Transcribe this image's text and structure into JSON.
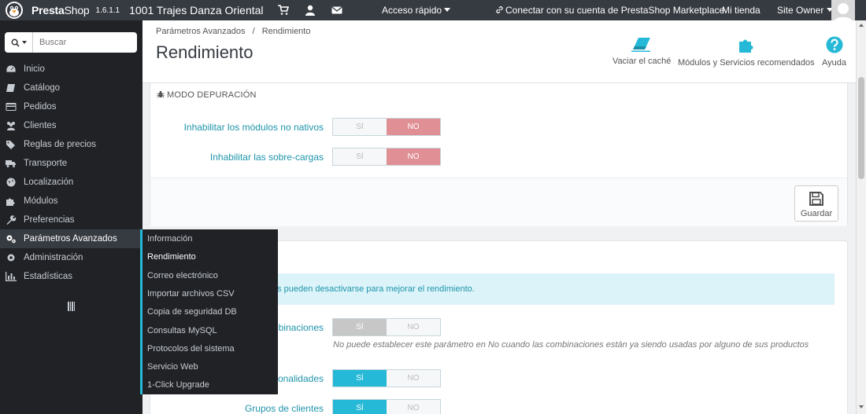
{
  "topbar": {
    "brand_pre": "Presta",
    "brand_post": "Shop",
    "version": "1.6.1.1",
    "shop_name": "1001 Trajes Danza Oriental",
    "quick_access": "Acceso rápido",
    "connect": "Conectar con su cuenta de PrestaShop Marketplace",
    "my_store": "Mi tienda",
    "user": "Site Owner"
  },
  "search": {
    "placeholder": "Buscar"
  },
  "sidebar": {
    "items": [
      {
        "label": "Inicio",
        "icon": "tachometer-icon"
      },
      {
        "label": "Catálogo",
        "icon": "book-icon"
      },
      {
        "label": "Pedidos",
        "icon": "credit-card-icon"
      },
      {
        "label": "Clientes",
        "icon": "users-icon"
      },
      {
        "label": "Reglas de precios",
        "icon": "tags-icon"
      },
      {
        "label": "Transporte",
        "icon": "truck-icon"
      },
      {
        "label": "Localización",
        "icon": "globe-icon"
      },
      {
        "label": "Módulos",
        "icon": "puzzle-icon"
      },
      {
        "label": "Preferencias",
        "icon": "wrench-icon"
      },
      {
        "label": "Parámetros Avanzados",
        "icon": "cogs-icon"
      },
      {
        "label": "Administración",
        "icon": "cog-icon"
      },
      {
        "label": "Estadísticas",
        "icon": "bar-chart-icon"
      }
    ]
  },
  "submenu": {
    "items": [
      "Información",
      "Rendimiento",
      "Correo electrónico",
      "Importar archivos CSV",
      "Copia de seguridad DB",
      "Consultas MySQL",
      "Protocolos del sistema",
      "Servicio Web",
      "1-Click Upgrade"
    ]
  },
  "header": {
    "breadcrumb_parent": "Parámetros Avanzados",
    "breadcrumb_sep": "/",
    "breadcrumb_current": "Rendimiento",
    "title": "Rendimiento",
    "tools": [
      {
        "label": "Vaciar el caché",
        "icon": "eraser-icon"
      },
      {
        "label": "Módulos y Servicios recomendados",
        "icon": "puzzle-icon"
      },
      {
        "label": "Ayuda",
        "icon": "help-icon"
      }
    ]
  },
  "debug_panel": {
    "heading": "MODO DEPURACIÓN",
    "rows": [
      {
        "label": "Inhabilitar los módulos no nativos",
        "yes": "SÍ",
        "no": "NO",
        "value": "NO"
      },
      {
        "label": "Inhabilitar las sobre-cargas",
        "yes": "SÍ",
        "no": "NO",
        "value": "NO"
      }
    ],
    "save_label": "Guardar"
  },
  "features_panel": {
    "alert": "as pueden desactivarse para mejorar el rendimiento.",
    "rows": [
      {
        "label": "binaciones",
        "yes": "SÍ",
        "no": "NO",
        "value": "SÍ",
        "disabled": true,
        "help": "No puede establecer este parámetro en No cuando las combinaciones están ya siendo usadas por alguno de sus productos"
      },
      {
        "label": "onalidades",
        "yes": "SÍ",
        "no": "NO",
        "value": "SÍ"
      },
      {
        "label": "Grupos de clientes",
        "yes": "SÍ",
        "no": "NO",
        "value": "SÍ"
      }
    ]
  },
  "colors": {
    "topbar": "#363a41",
    "sidebar": "#202226",
    "accent": "#25b9d7",
    "no_active": "#e08f95",
    "link": "#1e94ab"
  }
}
